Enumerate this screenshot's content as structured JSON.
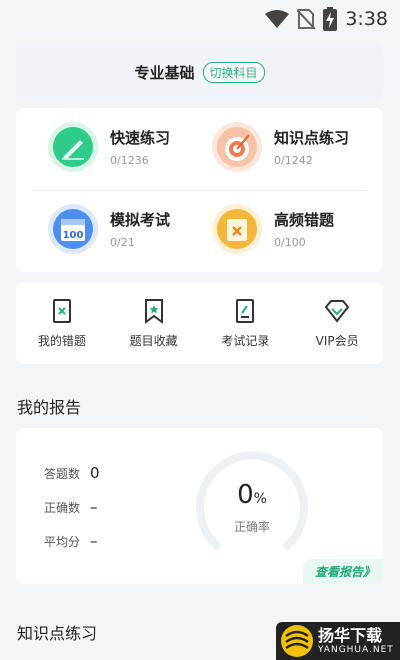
{
  "status_bar": {
    "time": "3:38"
  },
  "subject": {
    "title": "专业基础",
    "switch_label": "切换科目"
  },
  "practice": [
    {
      "title": "快速练习",
      "count": "0/1236",
      "icon": "pencil-icon",
      "color": "#2ecb8a"
    },
    {
      "title": "知识点练习",
      "count": "0/1242",
      "icon": "target-icon",
      "color": "#f27a4a"
    },
    {
      "title": "模拟考试",
      "count": "0/21",
      "icon": "calendar-icon",
      "color": "#4d8ef0"
    },
    {
      "title": "高频错题",
      "count": "0/100",
      "icon": "error-book-icon",
      "color": "#f5b73b"
    }
  ],
  "tools": [
    {
      "label": "我的错题",
      "icon": "wrong-book-icon"
    },
    {
      "label": "题目收藏",
      "icon": "bookmark-icon"
    },
    {
      "label": "考试记录",
      "icon": "exam-record-icon"
    },
    {
      "label": "VIP会员",
      "icon": "diamond-icon"
    }
  ],
  "report": {
    "section_title": "我的报告",
    "stats": [
      {
        "label": "答题数",
        "value": "0"
      },
      {
        "label": "正确数",
        "value": "–"
      },
      {
        "label": "平均分",
        "value": "–"
      }
    ],
    "percent_value": "0",
    "percent_unit": "%",
    "percent_label": "正确率",
    "accuracy_fraction": 0,
    "view_label": "查看报告》"
  },
  "knowledge": {
    "section_title": "知识点练习"
  },
  "watermark": {
    "cn": "扬华下载",
    "en": "YANGHUA.NET"
  },
  "colors": {
    "accent": "#23b07b",
    "background": "#f4f5f7"
  }
}
